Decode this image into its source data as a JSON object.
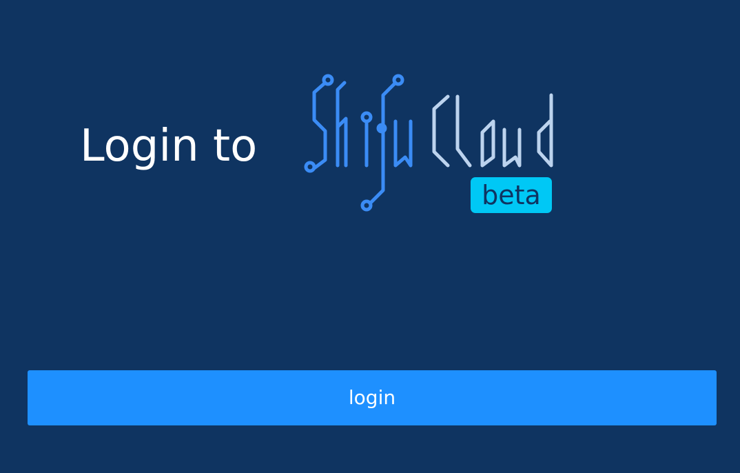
{
  "header": {
    "title": "Login to"
  },
  "logo": {
    "name": "Shifu Cloud",
    "badge": "beta",
    "colors": {
      "shifu": "#3b8cf5",
      "cloud": "#bcd3ee",
      "badge_bg": "#00c8f5",
      "badge_text": "#0f3461"
    }
  },
  "actions": {
    "login_label": "login"
  },
  "theme": {
    "background": "#0f3461",
    "button": "#1e90ff",
    "text": "#ffffff"
  }
}
